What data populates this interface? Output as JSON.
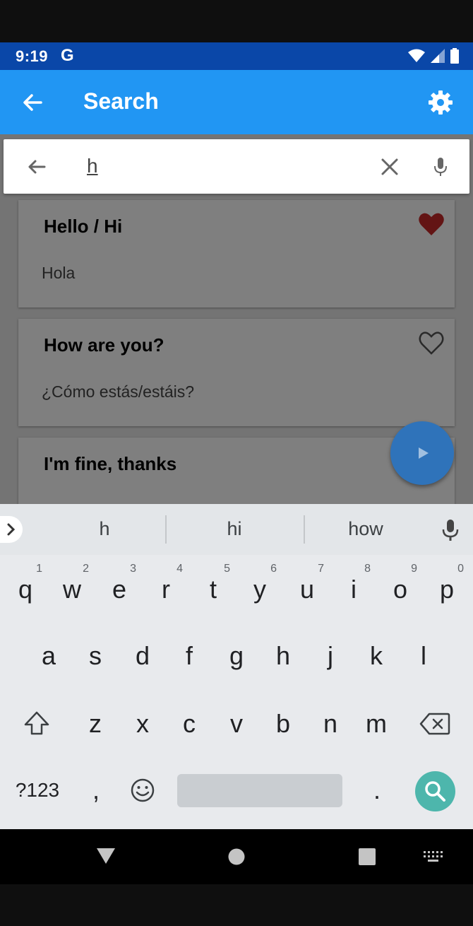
{
  "status_bar": {
    "time": "9:19",
    "g_logo": "G"
  },
  "app_bar": {
    "title": "Search",
    "back_icon": "arrow-back-icon",
    "settings_icon": "gear-icon"
  },
  "search": {
    "query": "h"
  },
  "results": [
    {
      "phrase": "Hello / Hi",
      "translation": "Hola",
      "favorite": true
    },
    {
      "phrase": "How are you?",
      "translation": "¿Cómo estás/estáis?",
      "favorite": false
    },
    {
      "phrase": "I'm fine, thanks",
      "translation": "",
      "favorite": false
    }
  ],
  "keyboard": {
    "suggestions": [
      "h",
      "hi",
      "how"
    ],
    "row1": [
      {
        "k": "q",
        "h": "1"
      },
      {
        "k": "w",
        "h": "2"
      },
      {
        "k": "e",
        "h": "3"
      },
      {
        "k": "r",
        "h": "4"
      },
      {
        "k": "t",
        "h": "5"
      },
      {
        "k": "y",
        "h": "6"
      },
      {
        "k": "u",
        "h": "7"
      },
      {
        "k": "i",
        "h": "8"
      },
      {
        "k": "o",
        "h": "9"
      },
      {
        "k": "p",
        "h": "0"
      }
    ],
    "row2": [
      "a",
      "s",
      "d",
      "f",
      "g",
      "h",
      "j",
      "k",
      "l"
    ],
    "row3": [
      "z",
      "x",
      "c",
      "v",
      "b",
      "n",
      "m"
    ],
    "symbols_label": "?123",
    "comma": ",",
    "period": "."
  },
  "colors": {
    "app_bar": "#2196f3",
    "status_bar": "#0a47a8",
    "heart_filled": "#c62828",
    "fab": "#2f73ba",
    "search_key": "#4db6ac"
  }
}
